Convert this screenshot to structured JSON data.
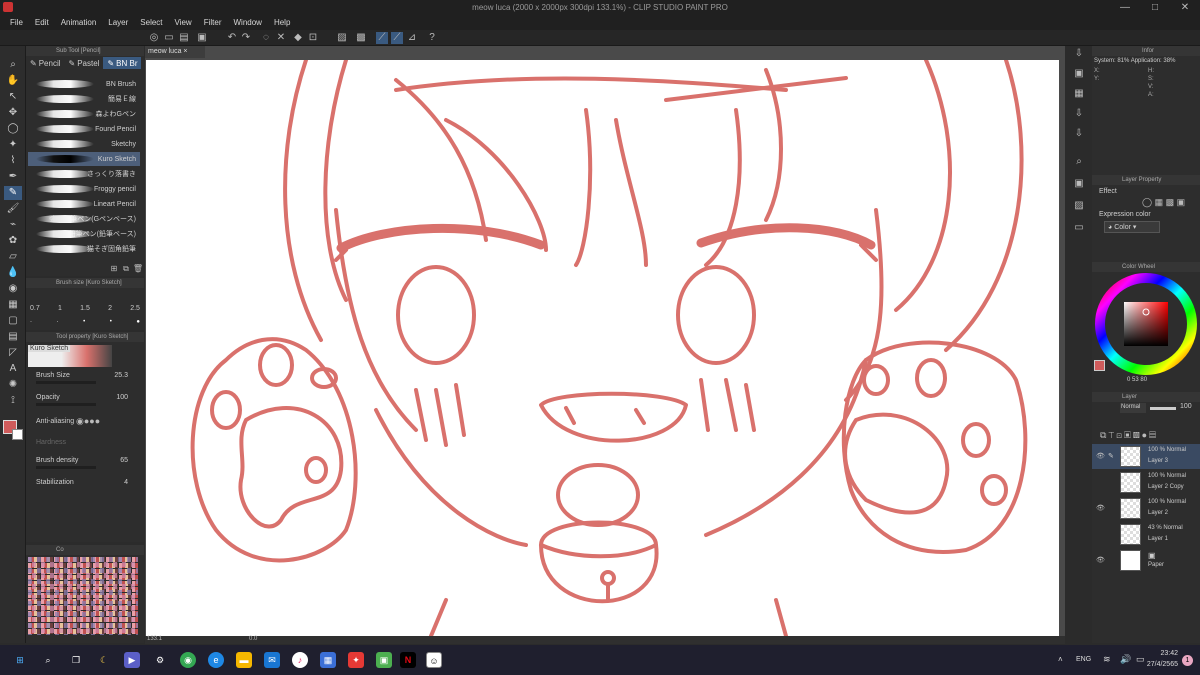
{
  "window": {
    "title": "meow luca (2000 x 2000px 300dpi 133.1%)  - CLIP STUDIO PAINT PRO",
    "controls": [
      "—",
      "□",
      "✕"
    ]
  },
  "menu": [
    "File",
    "Edit",
    "Animation",
    "Layer",
    "Select",
    "View",
    "Filter",
    "Window",
    "Help"
  ],
  "sub_tool": {
    "header": "Sub Tool [Pencil]",
    "tabs": [
      "Pencil",
      "Pastel",
      "BN Br"
    ],
    "brushes": [
      {
        "name": "BN Brush",
        "selected": false
      },
      {
        "name": "簡易Ｅ線",
        "selected": false
      },
      {
        "name": "森よわGペン",
        "selected": false
      },
      {
        "name": "Found Pencil",
        "selected": false
      },
      {
        "name": "Sketchy",
        "selected": false
      },
      {
        "name": "Kuro Sketch",
        "selected": true
      },
      {
        "name": "さっくり落書き",
        "selected": false
      },
      {
        "name": "Froggy pencil",
        "selected": false
      },
      {
        "name": "Lineart Pencil",
        "selected": false
      },
      {
        "name": "強弱鉛筆ペン(Gペンベース)",
        "selected": false
      },
      {
        "name": "強弱鉛筆ペン(鉛筆ベース)",
        "selected": false
      },
      {
        "name": "猫そぎ固角鉛筆",
        "selected": false
      }
    ]
  },
  "brush_size_panel": {
    "header": "Brush size [Kuro Sketch]",
    "sizes": [
      "0.7",
      "1",
      "1.5",
      "2",
      "2.5"
    ]
  },
  "tool_property": {
    "header": "Tool property [Kuro Sketch]",
    "preset_name": "Kuro Sketch",
    "brush_size_label": "Brush Size",
    "brush_size_value": "25.3",
    "opacity_label": "Opacity",
    "opacity_value": "100",
    "anti_aliasing_label": "Anti-aliasing",
    "hardness_label": "Hardness",
    "brush_density_label": "Brush density",
    "brush_density_value": "65",
    "stabilization_label": "Stabilization",
    "stabilization_value": "4"
  },
  "color_set": {
    "header": "Co"
  },
  "document": {
    "tab_label": "meow luca",
    "tab_close": "×"
  },
  "status_bar": {
    "zoom": "133.1",
    "angle": "0.0"
  },
  "info_panel": {
    "header": "Infor",
    "system_label": "System: 81%",
    "application_label": "Application: 38%",
    "x_label": "X:",
    "y_label": "Y:",
    "h_label": "H:",
    "s_label": "S:",
    "v_label": "V:",
    "a_label": "A:"
  },
  "layer_property": {
    "header": "Layer Property",
    "effect_label": "Effect",
    "expression_color_label": "Expression color",
    "expression_color_value": "Color"
  },
  "color_wheel": {
    "header": "Color Wheel",
    "h_value": "0",
    "s_value": "53",
    "v_value": "80"
  },
  "layer_panel": {
    "header": "Layer",
    "blend_mode": "Normal",
    "opacity": "100",
    "layers": [
      {
        "line1": "100 % Normal",
        "line2": "Layer 3",
        "selected": true,
        "visible": true
      },
      {
        "line1": "100 % Normal",
        "line2": "Layer 2 Copy",
        "selected": false,
        "visible": false
      },
      {
        "line1": "100 % Normal",
        "line2": "Layer 2",
        "selected": false,
        "visible": true
      },
      {
        "line1": "43 % Normal",
        "line2": "Layer 1",
        "selected": false,
        "visible": false
      },
      {
        "line1": "",
        "line2": "Paper",
        "selected": false,
        "visible": true
      }
    ]
  },
  "taskbar": {
    "language": "ENG",
    "time": "23:42",
    "date": "27/4/2565",
    "notification_count": "1",
    "apps": [
      "start",
      "search",
      "task-view",
      "widget",
      "teams",
      "settings",
      "chrome",
      "edge",
      "explorer",
      "mail",
      "itunes",
      "store",
      "valorant",
      "minecraft",
      "netflix",
      "clip-studio"
    ]
  },
  "colors": {
    "accent": "#3a5a80",
    "stroke": "#d9716c",
    "main_color": "#cf5b5b",
    "panel_bg": "#2d2d2d",
    "canvas_bg": "#ffffff"
  }
}
